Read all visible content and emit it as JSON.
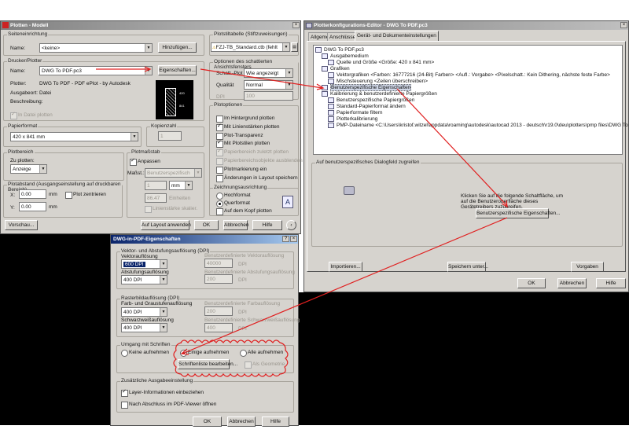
{
  "plot": {
    "title": "Plotten - Modell",
    "page_setup": {
      "group": "Seiteneinrichtung",
      "name_label": "Name:",
      "name_value": "<keine>",
      "add_button": "Hinzufügen..."
    },
    "printer": {
      "group": "Drucker/Plotter",
      "name_label": "Name:",
      "name_value": "DWG To PDF.pc3",
      "properties_button": "Eigenschaften...",
      "plotter_label": "Plotter:",
      "plotter_value": "DWG To PDF - PDF ePlot - by Autodesk",
      "output_label": "Ausgabeort:",
      "output_value": "Datei",
      "desc_label": "Beschreibung:",
      "plot_to_file": "In Datei plotten",
      "preview_dim_w": "420",
      "preview_dim_h": "841"
    },
    "paper": {
      "group": "Papierformat",
      "value": "420 x 841 mm"
    },
    "copies": {
      "group": "Kopienzahl",
      "value": "1"
    },
    "area": {
      "group": "Plotbereich",
      "what_label": "Zu plotten:",
      "what_value": "Anzeige"
    },
    "offset": {
      "group": "Plotabstand (Ausgangseinstellung auf druckbaren Bereich)",
      "x_label": "X:",
      "x_value": "0.00",
      "y_label": "Y:",
      "y_value": "0.00",
      "unit": "mm",
      "center": "Plot zentrieren"
    },
    "scale": {
      "group": "Plotmaßstab",
      "fit": "Anpassen",
      "scale_label": "Maßst.:",
      "scale_value": "Benutzerspezifisch",
      "v1": "1",
      "unit": "mm",
      "v2": "86.47",
      "units": "Einheiten",
      "lineweights": "Linienstärke skalier."
    },
    "style_table": {
      "group": "Plotstiltabelle (Stiftzuweisungen)",
      "value": "FZJ-TB_Standard.ctb (fehlt"
    },
    "shaded": {
      "group": "Optionen des schattierten Ansichtsfensters",
      "shade_label": "Schatt.-Plot",
      "shade_value": "Wie angezeigt",
      "quality_label": "Qualität",
      "quality_value": "Normal",
      "dpi_label": "DPI",
      "dpi_value": "100"
    },
    "options": {
      "group": "Plotoptionen",
      "items": [
        {
          "label": "Im Hintergrund plotten",
          "checked": false,
          "disabled": false
        },
        {
          "label": "Mit Linienstärken plotten",
          "checked": true,
          "disabled": false
        },
        {
          "label": "Plot-Transparenz",
          "checked": false,
          "disabled": false
        },
        {
          "label": "Mit Plotstilen plotten",
          "checked": true,
          "disabled": false
        },
        {
          "label": "Papierbereich zuletzt plotten",
          "checked": true,
          "disabled": true
        },
        {
          "label": "Papierbereichsobjekte ausblenden",
          "checked": false,
          "disabled": true
        },
        {
          "label": "Plotmarkierung ein",
          "checked": false,
          "disabled": false
        },
        {
          "label": "Änderungen in Layout speichern",
          "checked": false,
          "disabled": false
        }
      ]
    },
    "orientation": {
      "group": "Zeichnungsausrichtung",
      "portrait": "Hochformat",
      "landscape": "Querformat",
      "upside": "Auf dem Kopf plotten"
    },
    "buttons": {
      "preview": "Vorschau...",
      "apply": "Auf Layout anwenden",
      "ok": "OK",
      "cancel": "Abbrechen",
      "help": "Hilfe"
    }
  },
  "config": {
    "title": "Plotterkonfigurations-Editor - DWG To PDF.pc3",
    "tabs": [
      "Allgemein",
      "Anschlüsse",
      "Gerät- und Dokumenteinstellungen"
    ],
    "tree": [
      {
        "label": "DWG To PDF.pc3",
        "level": 0
      },
      {
        "label": "Ausgabemedium",
        "level": 1
      },
      {
        "label": "Quelle und Größe <Größe: 420 x 841 mm>",
        "level": 2
      },
      {
        "label": "Grafiken",
        "level": 1
      },
      {
        "label": "Vektorgrafiken <Farben: 16777216 (24-Bit) Farben> <Aufl.: Vorgabe> <Pixelschatt.: Kein Dithering, nächste feste Farbe>",
        "level": 2
      },
      {
        "label": "Mischsteuerung <Zeilen überschreiben>",
        "level": 2
      },
      {
        "label": "Benutzerspezifische Eigenschaften",
        "level": 1,
        "selected": true
      },
      {
        "label": "Kalibrierung & benutzerdefinierte Papiergrößen",
        "level": 1
      },
      {
        "label": "Benutzerspezifische Papiergrößen",
        "level": 2
      },
      {
        "label": "Standard-Papierformat ändern",
        "level": 2
      },
      {
        "label": "Papierformate filtern",
        "level": 2
      },
      {
        "label": "Plotterkalibrierung",
        "level": 2
      },
      {
        "label": "PMP-Dateiname <C:\\Users\\kristof.witzel\\appdata\\roaming\\autodesk\\autocad 2013 - deutsch\\r19.0\\deu\\plotters\\pmp files\\DWG To PDF.pmp>",
        "level": 2
      }
    ],
    "access": {
      "group": "Auf benutzerspezifisches Dialogfeld zugreifen",
      "text": "Klicken Sie auf die folgende Schaltfläche, um auf die Benutzeroberfläche dieses Gerätetreibers zuzugreifen.",
      "button": "Benutzerspezifische Eigenschaften..."
    },
    "buttons": {
      "import": "Importieren...",
      "save_as": "Speichern unter...",
      "defaults": "Vorgaben",
      "ok": "OK",
      "cancel": "Abbrechen",
      "help": "Hilfe"
    }
  },
  "pdf": {
    "title": "DWG-in-PDF-Eigenschaften",
    "vector": {
      "group": "Vektor- und Abstufungsauflösung (DPI)",
      "vec_label": "Vektorauflösung",
      "vec_value": "600 DPI",
      "grad_label": "Abstufungsauflösung",
      "grad_value": "400 DPI",
      "cust_vec_label": "Benutzerdefinierte Vektorauflösung",
      "cust_vec_value": "40000",
      "cust_grad_label": "Benutzerdefinierte Abstufungsauflösung",
      "cust_grad_value": "200",
      "dpi": "DPI"
    },
    "raster": {
      "group": "Rasterbildauflösung (DPI)",
      "color_label": "Farb- und Graustufenauflösung",
      "color_value": "400 DPI",
      "bw_label": "Schwarzweißauflösung",
      "bw_value": "400 DPI",
      "cust_color_label": "Benutzerdefinierte Farbauflösung",
      "cust_color_value": "200",
      "cust_bw_label": "Benutzerdefinierte Schwarzweißauflösung",
      "cust_bw_value": "400",
      "dpi": "DPI"
    },
    "fonts": {
      "group": "Umgang mit Schriften",
      "none": "Keine aufnehmen",
      "some": "Einige aufnehmen",
      "all": "Alle aufnehmen",
      "edit_button": "Schriftenliste bearbeiten...",
      "as_geometry": "Als Geometrie"
    },
    "extra": {
      "group": "Zusätzliche Ausgabeeinstellung",
      "layers": "Layer-Informationen einbeziehen",
      "open_viewer": "Nach Abschluss im PDF-Viewer öffnen"
    },
    "buttons": {
      "ok": "OK",
      "cancel": "Abbrechen",
      "help": "Hilfe"
    }
  },
  "colors": {
    "annotation": "#e02020",
    "titlebar_active": "#0a246a",
    "dialog_bg": "#d6d3ce"
  }
}
